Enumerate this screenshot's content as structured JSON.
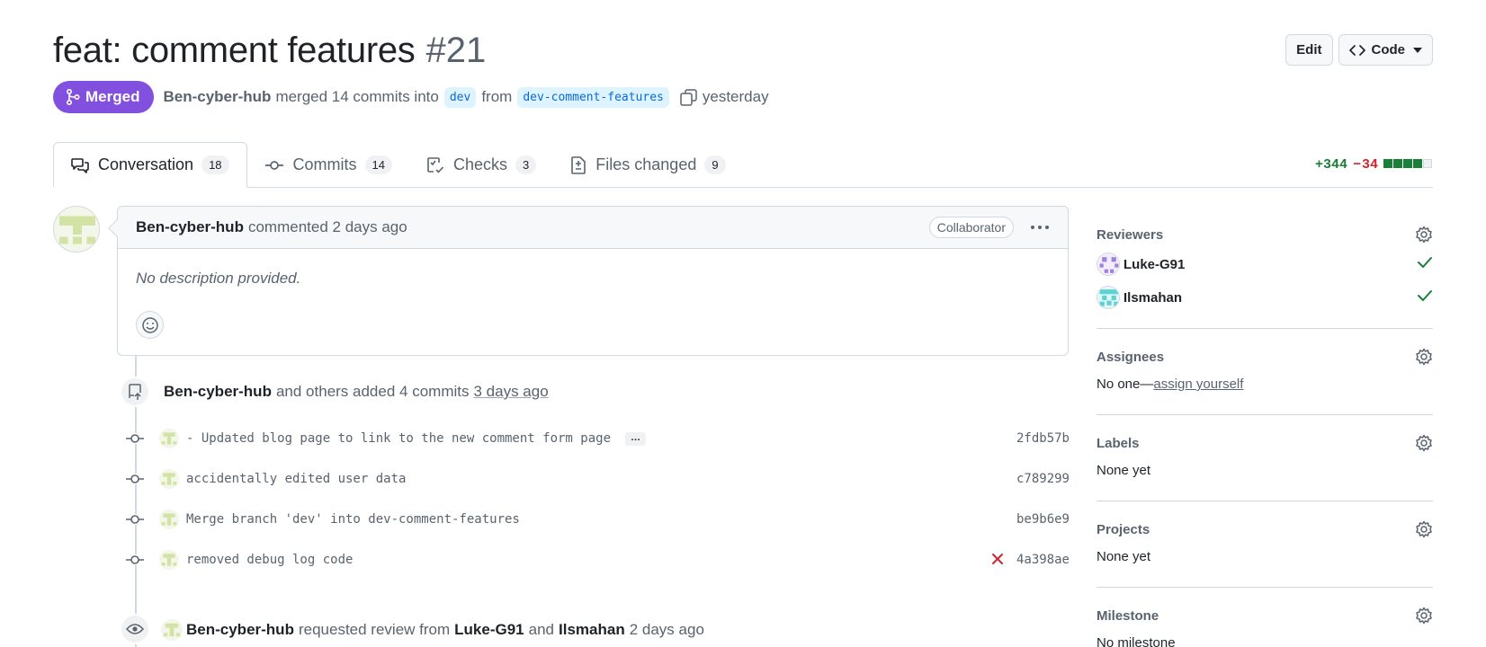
{
  "pr": {
    "title": "feat: comment features",
    "number": "#21",
    "status": "Merged",
    "author": "Ben-cyber-hub",
    "merge_text": "merged 14 commits into",
    "base_branch": "dev",
    "from_text": "from",
    "head_branch": "dev-comment-features",
    "when": "yesterday"
  },
  "actions": {
    "edit_label": "Edit",
    "code_label": "Code"
  },
  "tabs": [
    {
      "label": "Conversation",
      "count": "18",
      "icon": "comment-discussion-icon"
    },
    {
      "label": "Commits",
      "count": "14",
      "icon": "commit-icon"
    },
    {
      "label": "Checks",
      "count": "3",
      "icon": "checklist-icon"
    },
    {
      "label": "Files changed",
      "count": "9",
      "icon": "file-diff-icon"
    }
  ],
  "diffstat": {
    "additions": "+344",
    "deletions": "− 34",
    "blocks_green": 4,
    "blocks_gray": 1
  },
  "comment": {
    "author": "Ben-cyber-hub",
    "action": "commented 2 days ago",
    "role": "Collaborator",
    "body": "No description provided."
  },
  "commits_event": {
    "author": "Ben-cyber-hub",
    "text": "and others added 4 commits",
    "when": "3 days ago"
  },
  "commits": [
    {
      "message": "- Updated blog page to link to the new comment form page",
      "sha": "2fdb57b",
      "has_more": true,
      "failed": false
    },
    {
      "message": "accidentally edited user data",
      "sha": "c789299",
      "has_more": false,
      "failed": false
    },
    {
      "message": "Merge branch 'dev' into dev-comment-features",
      "sha": "be9b6e9",
      "has_more": false,
      "failed": false
    },
    {
      "message": "removed debug log code",
      "sha": "4a398ae",
      "has_more": false,
      "failed": true
    }
  ],
  "review_event": {
    "author": "Ben-cyber-hub",
    "text": "requested review from",
    "reviewer1": "Luke-G91",
    "and": "and",
    "reviewer2": "Ilsmahan",
    "when": "2 days ago"
  },
  "sidebar": {
    "reviewers": {
      "heading": "Reviewers",
      "items": [
        {
          "name": "Luke-G91",
          "approved": true
        },
        {
          "name": "Ilsmahan",
          "approved": true
        }
      ]
    },
    "assignees": {
      "heading": "Assignees",
      "prefix": "No one—",
      "link": "assign yourself"
    },
    "labels": {
      "heading": "Labels",
      "value": "None yet"
    },
    "projects": {
      "heading": "Projects",
      "value": "None yet"
    },
    "milestone": {
      "heading": "Milestone",
      "value": "No milestone"
    }
  },
  "colors": {
    "merged": "#8250df",
    "accent": "#0969da",
    "success": "#1a7f37",
    "danger": "#d1242f"
  }
}
